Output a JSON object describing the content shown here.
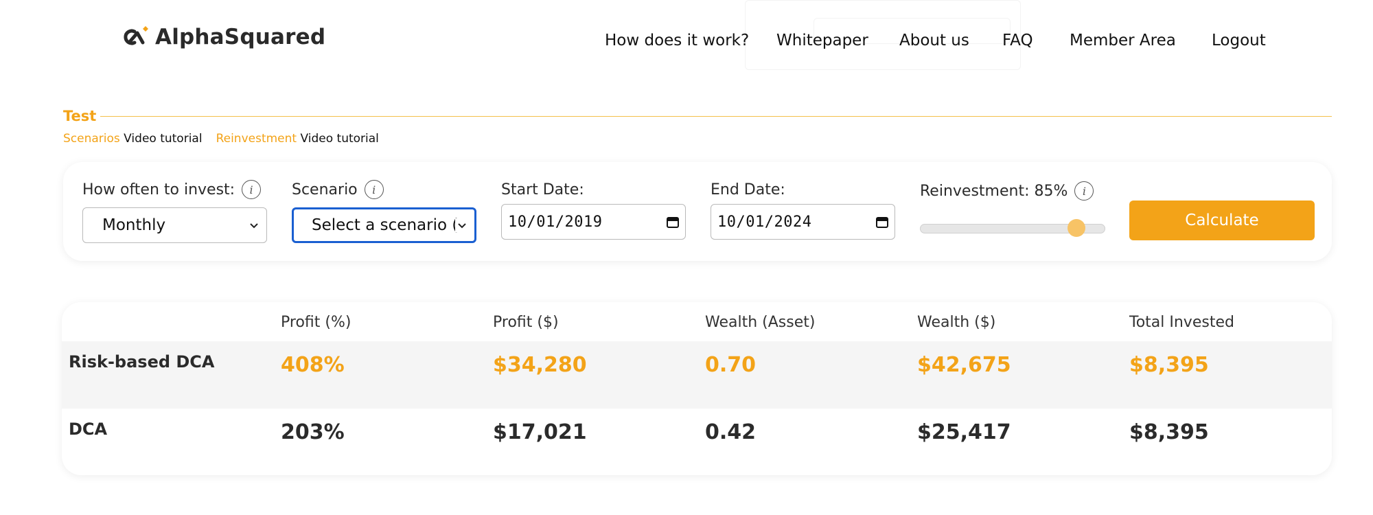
{
  "brand": {
    "name": "AlphaSquared",
    "accent": "#f3a318",
    "logo_icon": "alphasquared-logo-icon"
  },
  "nav": {
    "items": [
      {
        "label": "How does it work?"
      },
      {
        "label": "Whitepaper"
      },
      {
        "label": "About us"
      },
      {
        "label": "FAQ"
      },
      {
        "label": "Member Area"
      },
      {
        "label": "Logout"
      }
    ]
  },
  "section": {
    "title": "Test",
    "tutorials": [
      {
        "accent": "Scenarios",
        "text": "Video tutorial"
      },
      {
        "accent": "Reinvestment",
        "text": "Video tutorial"
      }
    ]
  },
  "form": {
    "frequency": {
      "label": "How often to invest:",
      "value": "Monthly",
      "icon": "info-icon"
    },
    "scenario": {
      "label": "Scenario",
      "value": "Select a scenario (",
      "icon": "info-icon"
    },
    "start_date": {
      "label": "Start Date:",
      "value": "10/01/2019",
      "icon": "calendar-icon"
    },
    "end_date": {
      "label": "End Date:",
      "value": "10/01/2024",
      "icon": "calendar-icon"
    },
    "reinvestment": {
      "label": "Reinvestment: 85%",
      "value_fraction": 0.85,
      "icon": "info-icon"
    },
    "calculate_label": "Calculate"
  },
  "results": {
    "columns": [
      "Profit (%)",
      "Profit ($)",
      "Wealth (Asset)",
      "Wealth ($)",
      "Total Invested"
    ],
    "rows": [
      {
        "label": "Risk-based DCA",
        "values": [
          "408%",
          "$34,280",
          "0.70",
          "$42,675",
          "$8,395"
        ],
        "highlight": true
      },
      {
        "label": "DCA",
        "values": [
          "203%",
          "$17,021",
          "0.42",
          "$25,417",
          "$8,395"
        ],
        "highlight": false
      }
    ]
  }
}
